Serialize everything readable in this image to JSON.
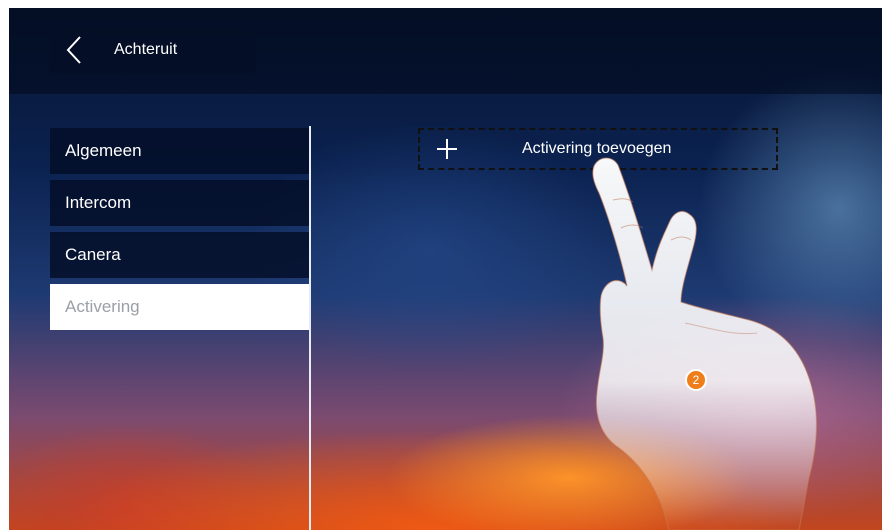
{
  "header": {
    "back_label": "Achteruit"
  },
  "menu": {
    "items": [
      {
        "label": "Algemeen"
      },
      {
        "label": "Intercom"
      },
      {
        "label": "Canera"
      },
      {
        "label": "Activering"
      }
    ],
    "active_index": 3
  },
  "main": {
    "add_button_label": "Activering toevoegen"
  },
  "annotation": {
    "step_number": "2"
  },
  "icons": {
    "back": "chevron-left-icon",
    "add": "plus-icon",
    "pointer": "hand-pointer-icon"
  },
  "colors": {
    "badge": "#ef7d1a",
    "active_item_bg": "#ffffff",
    "active_item_text": "#9aa0a6"
  }
}
